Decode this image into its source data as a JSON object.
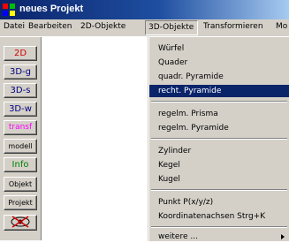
{
  "window": {
    "title": "neues Projekt"
  },
  "menubar": [
    "Datei",
    "Bearbeiten",
    "2D-Objekte",
    "3D-Objekte",
    "Transformieren",
    "Mo"
  ],
  "sidebar": {
    "buttons": [
      {
        "label": "2D",
        "color": "#cc0000"
      },
      {
        "label": "3D-g",
        "color": "#000080"
      },
      {
        "label": "3D-s",
        "color": "#000080"
      },
      {
        "label": "3D-w",
        "color": "#000080"
      },
      {
        "label": "transf",
        "color": "#ff00ff"
      },
      {
        "label": "modell",
        "color": "#000000"
      },
      {
        "label": "Info",
        "color": "#008000"
      },
      {
        "label": "Objekt",
        "color": "#000000"
      },
      {
        "label": "Projekt",
        "color": "#000000"
      },
      {
        "label": "",
        "color": "#cc0000",
        "icon": "no-eye-icon"
      }
    ]
  },
  "dropdown": {
    "items": [
      "Würfel",
      "Quader",
      "quadr. Pyramide",
      "recht. Pyramide",
      "regelm. Prisma",
      "regelm. Pyramide",
      "Zylinder",
      "Kegel",
      "Kugel",
      "Punkt P(x/y/z)",
      "Koordinatenachsen  Strg+K",
      "weitere ..."
    ],
    "selected": "recht. Pyramide"
  }
}
